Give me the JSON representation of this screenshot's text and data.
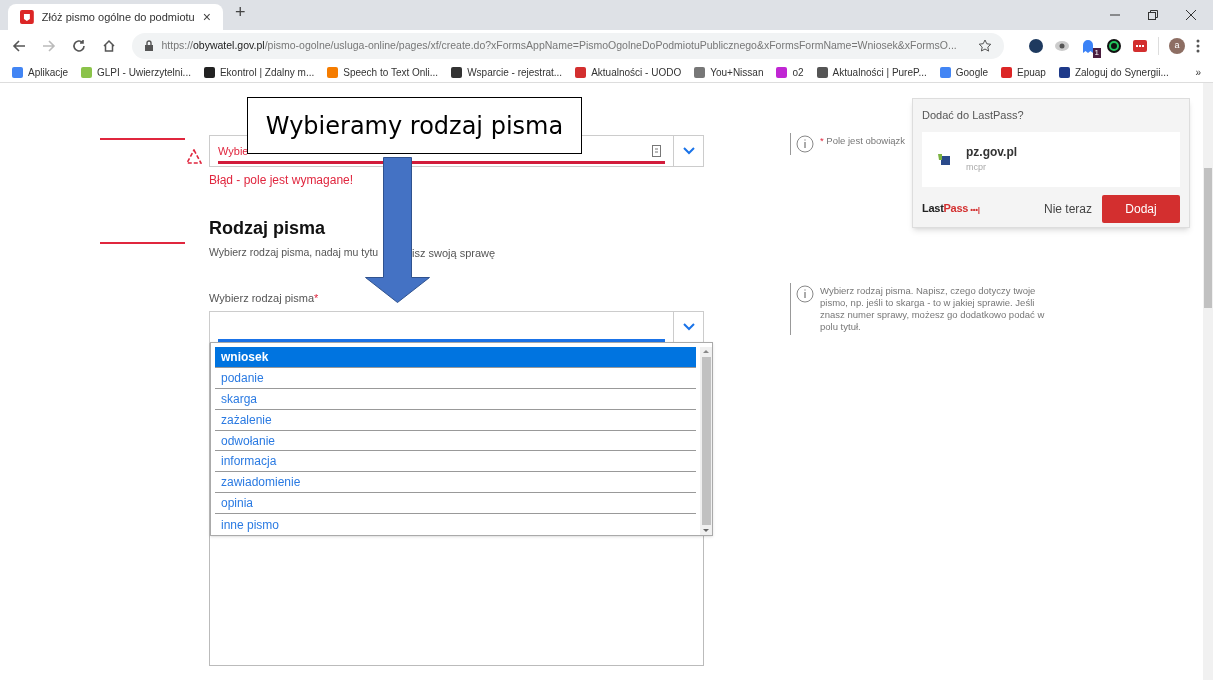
{
  "browser": {
    "tab": {
      "title": "Złóż pismo ogólne do podmiotu",
      "close": "×"
    },
    "new_tab": "+",
    "url": {
      "scheme": "https://",
      "host": "obywatel.gov.pl",
      "path": "/pismo-ogolne/usluga-online/pages/xf/create.do?xFormsAppName=PismoOgolneDoPodmiotuPublicznego&xFormsFormName=Wniosek&xFormsO..."
    },
    "bookmarks": [
      {
        "label": "Aplikacje",
        "color": "#4285f4"
      },
      {
        "label": "GLPI - Uwierzytelni...",
        "color": "#8bc34a"
      },
      {
        "label": "Ekontrol | Zdalny m...",
        "color": "#222222"
      },
      {
        "label": "Speech to Text Onli...",
        "color": "#f57c00"
      },
      {
        "label": "Wsparcie - rejestrat...",
        "color": "#333333"
      },
      {
        "label": "Aktualności - UODO",
        "color": "#d32f2f"
      },
      {
        "label": "You+Nissan",
        "color": "#777777"
      },
      {
        "label": "o2",
        "color": "#c026d3"
      },
      {
        "label": "Aktualności | PureP...",
        "color": "#555555"
      },
      {
        "label": "Google",
        "color": "#4285f4"
      },
      {
        "label": "Epuap",
        "color": "#dc2626"
      },
      {
        "label": "Zaloguj do Synergii...",
        "color": "#1e3a8a"
      }
    ],
    "bookmarks_more": "»",
    "extension_badge": "1",
    "avatar": "a"
  },
  "form": {
    "office_field": {
      "placeholder": "Wybie",
      "invalid": true
    },
    "error": "Błąd - pole jest wymagane!",
    "section_title": "Rodzaj pisma",
    "section_subtitle": [
      "Wybierz rodzaj pisma, nadaj mu tytu",
      "isz swoją sprawę"
    ],
    "type_label": "Wybierz rodzaj pisma",
    "required_mark": "*",
    "type_options": [
      {
        "label": "wniosek",
        "selected": true
      },
      {
        "label": "podanie",
        "selected": false
      },
      {
        "label": "skarga",
        "selected": false
      },
      {
        "label": "zażalenie",
        "selected": false
      },
      {
        "label": "odwołanie",
        "selected": false
      },
      {
        "label": "informacja",
        "selected": false
      },
      {
        "label": "zawiadomienie",
        "selected": false
      },
      {
        "label": "opinia",
        "selected": false
      },
      {
        "label": "inne pismo",
        "selected": false
      }
    ]
  },
  "hints": [
    {
      "mark": "*",
      "text": "Pole jest obowiązk"
    },
    {
      "text": "Wybierz rodzaj pisma. Napisz, czego dotyczy twoje pismo, np. jeśli to skarga - to w jakiej sprawie. Jeśli znasz numer sprawy, możesz go dodatkowo podać w polu tytuł."
    }
  ],
  "lastpass": {
    "title": "Dodać do LastPass?",
    "site": "pz.gov.pl",
    "user": "mcpr",
    "brand_dark": "Last",
    "brand_red": "Pass",
    "brand_dots": "•••|",
    "dismiss": "Nie teraz",
    "confirm": "Dodaj"
  },
  "callout": "Wybieramy rodzaj pisma"
}
